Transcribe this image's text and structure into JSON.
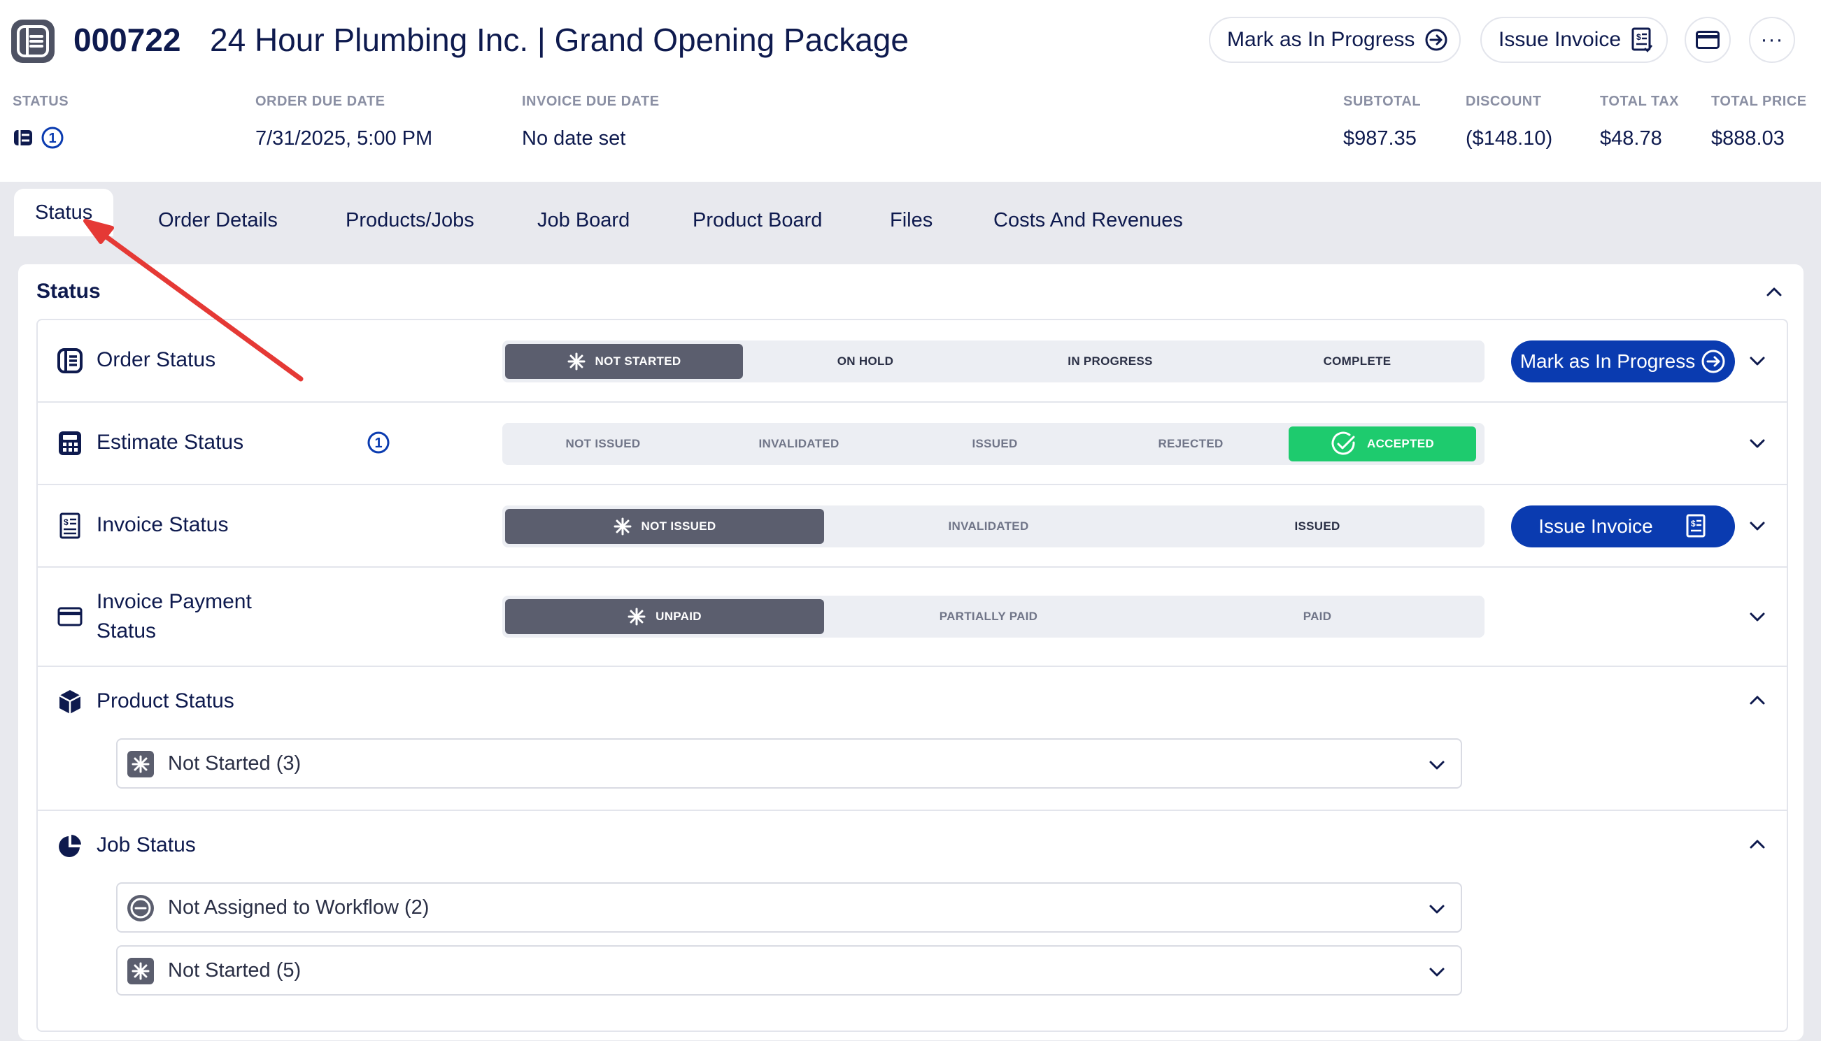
{
  "header": {
    "order_number": "000722",
    "title": "24 Hour Plumbing Inc. | Grand Opening Package",
    "mark_progress_label": "Mark as In Progress",
    "issue_invoice_label": "Issue Invoice",
    "more_label": "···"
  },
  "meta": {
    "status_label": "STATUS",
    "status_count": "1",
    "order_due_label": "ORDER DUE DATE",
    "order_due_value": "7/31/2025, 5:00 PM",
    "invoice_due_label": "INVOICE DUE DATE",
    "invoice_due_value": "No date set",
    "subtotal_label": "SUBTOTAL",
    "subtotal_value": "$987.35",
    "discount_label": "DISCOUNT",
    "discount_value": "($148.10)",
    "tax_label": "TOTAL TAX",
    "tax_value": "$48.78",
    "total_label": "TOTAL PRICE",
    "total_value": "$888.03"
  },
  "tabs": [
    {
      "label": "Status",
      "active": true
    },
    {
      "label": "Order Details"
    },
    {
      "label": "Products/Jobs"
    },
    {
      "label": "Job Board"
    },
    {
      "label": "Product Board"
    },
    {
      "label": "Files"
    },
    {
      "label": "Costs And Revenues"
    }
  ],
  "panel": {
    "title": "Status",
    "order_status": {
      "label": "Order Status",
      "options": [
        "NOT STARTED",
        "ON HOLD",
        "IN PROGRESS",
        "COMPLETE"
      ],
      "selected": "NOT STARTED",
      "action_label": "Mark as In Progress"
    },
    "estimate_status": {
      "label": "Estimate Status",
      "badge": "1",
      "options": [
        "NOT ISSUED",
        "INVALIDATED",
        "ISSUED",
        "REJECTED",
        "ACCEPTED"
      ],
      "selected": "ACCEPTED"
    },
    "invoice_status": {
      "label": "Invoice Status",
      "options": [
        "NOT ISSUED",
        "INVALIDATED",
        "ISSUED"
      ],
      "selected": "NOT ISSUED",
      "action_label": "Issue Invoice"
    },
    "payment_status": {
      "label_line1": "Invoice Payment",
      "label_line2": "Status",
      "options": [
        "UNPAID",
        "PARTIALLY PAID",
        "PAID"
      ],
      "selected": "UNPAID"
    },
    "product_status": {
      "label": "Product Status",
      "groups": [
        "Not Started (3)"
      ]
    },
    "job_status": {
      "label": "Job Status",
      "groups": [
        "Not Assigned to Workflow (2)",
        "Not Started (5)"
      ]
    }
  },
  "colors": {
    "brand_blue": "#0a3bb0",
    "accepted_green": "#1ecb6e",
    "selected_gray": "#5b5e6e",
    "annotation_red": "#e53935"
  }
}
